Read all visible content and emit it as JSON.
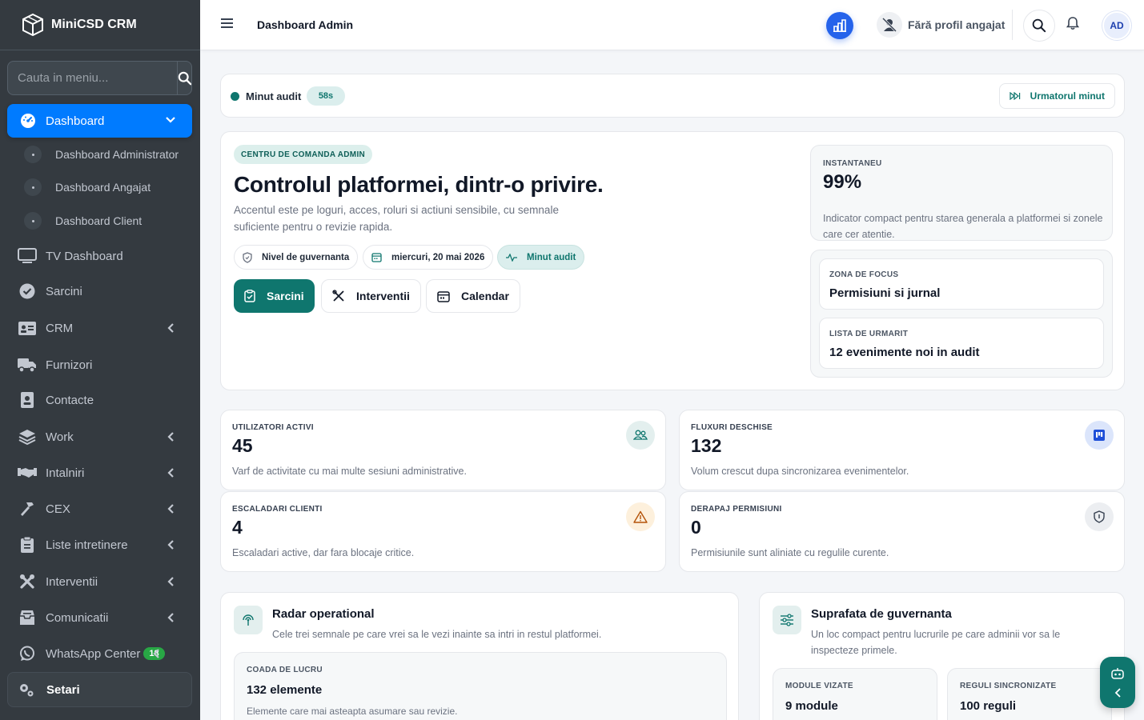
{
  "brand": {
    "name": "MiniCSD CRM"
  },
  "sidebar": {
    "search_placeholder": "Cauta in meniu...",
    "active": {
      "label": "Dashboard"
    },
    "sub_items": [
      {
        "label": "Dashboard Administrator"
      },
      {
        "label": "Dashboard Angajat"
      },
      {
        "label": "Dashboard Client"
      }
    ],
    "items": [
      {
        "label": "TV Dashboard",
        "icon": "monitor-icon"
      },
      {
        "label": "Sarcini",
        "icon": "check-circle-icon"
      },
      {
        "label": "CRM",
        "icon": "id-card-icon"
      },
      {
        "label": "Furnizori",
        "icon": "truck-icon"
      },
      {
        "label": "Contacte",
        "icon": "contact-card-icon"
      },
      {
        "label": "Work",
        "icon": "layers-icon"
      },
      {
        "label": "Intalniri",
        "icon": "handshake-icon"
      },
      {
        "label": "CEX",
        "icon": "hammer-icon"
      },
      {
        "label": "Liste intretinere",
        "icon": "clipboard-icon"
      },
      {
        "label": "Interventii",
        "icon": "tools-icon"
      },
      {
        "label": "Comunicatii",
        "icon": "inbox-icon"
      },
      {
        "label": "WhatsApp Center",
        "icon": "whatsapp-icon",
        "badge": "18"
      }
    ],
    "settings": {
      "label": "Setari"
    }
  },
  "topbar": {
    "title": "Dashboard Admin",
    "profile_label": "Fără profil angajat",
    "avatar_initials": "AD"
  },
  "audit": {
    "label": "Minut audit",
    "timer": "58s",
    "next_label": "Urmatorul minut"
  },
  "hero": {
    "eyebrow": "CENTRU DE COMANDA ADMIN",
    "title": "Controlul platformei, dintr-o privire.",
    "subtitle": "Accentul este pe loguri, acces, roluri si actiuni sensibile, cu semnale suficiente pentru o revizie rapida.",
    "chips": {
      "level": "Nivel de guvernanta",
      "date": "miercuri, 20 mai 2026",
      "audit": "Minut audit"
    },
    "buttons": {
      "tasks": "Sarcini",
      "interventions": "Interventii",
      "calendar": "Calendar"
    },
    "snapshot": {
      "label": "INSTANTANEU",
      "value": "99%",
      "desc": "Indicator compact pentru starea generala a platformei si zonele care cer atentie."
    },
    "focus": {
      "label": "ZONA DE FOCUS",
      "value": "Permisiuni si jurnal"
    },
    "watchlist": {
      "label": "LISTA DE URMARIT",
      "value": "12 evenimente noi in audit"
    }
  },
  "stats": [
    {
      "label": "UTILIZATORI ACTIVI",
      "value": "45",
      "desc": "Varf de activitate cu mai multe sesiuni administrative.",
      "icon": "users-icon",
      "color": "#e3efee"
    },
    {
      "label": "FLUXURI DESCHISE",
      "value": "132",
      "desc": "Volum crescut dupa sincronizarea evenimentelor.",
      "icon": "kanban-icon",
      "color": "#dbe5fb"
    },
    {
      "label": "ESCALADARI CLIENTI",
      "value": "4",
      "desc": "Escaladari active, dar fara blocaje critice.",
      "icon": "warning-icon",
      "color": "#fdf0dc"
    },
    {
      "label": "DERAPAJ PERMISIUNI",
      "value": "0",
      "desc": "Permisiunile sunt aliniate cu regulile curente.",
      "icon": "shield-icon",
      "color": "#eceef1"
    }
  ],
  "radar": {
    "title": "Radar operational",
    "subtitle": "Cele trei semnale pe care vrei sa le vezi inainte sa intri in restul platformei.",
    "queue": {
      "label": "COADA DE LUCRU",
      "value": "132 elemente",
      "desc": "Elemente care mai asteapta asumare sau revizie."
    }
  },
  "governance": {
    "title": "Suprafata de guvernanta",
    "subtitle": "Un loc compact pentru lucrurile pe care adminii vor sa le inspecteze primele.",
    "modules": {
      "label": "MODULE VIZATE",
      "value": "9 module"
    },
    "rules": {
      "label": "REGULI SINCRONIZATE",
      "value": "100 reguli"
    }
  }
}
